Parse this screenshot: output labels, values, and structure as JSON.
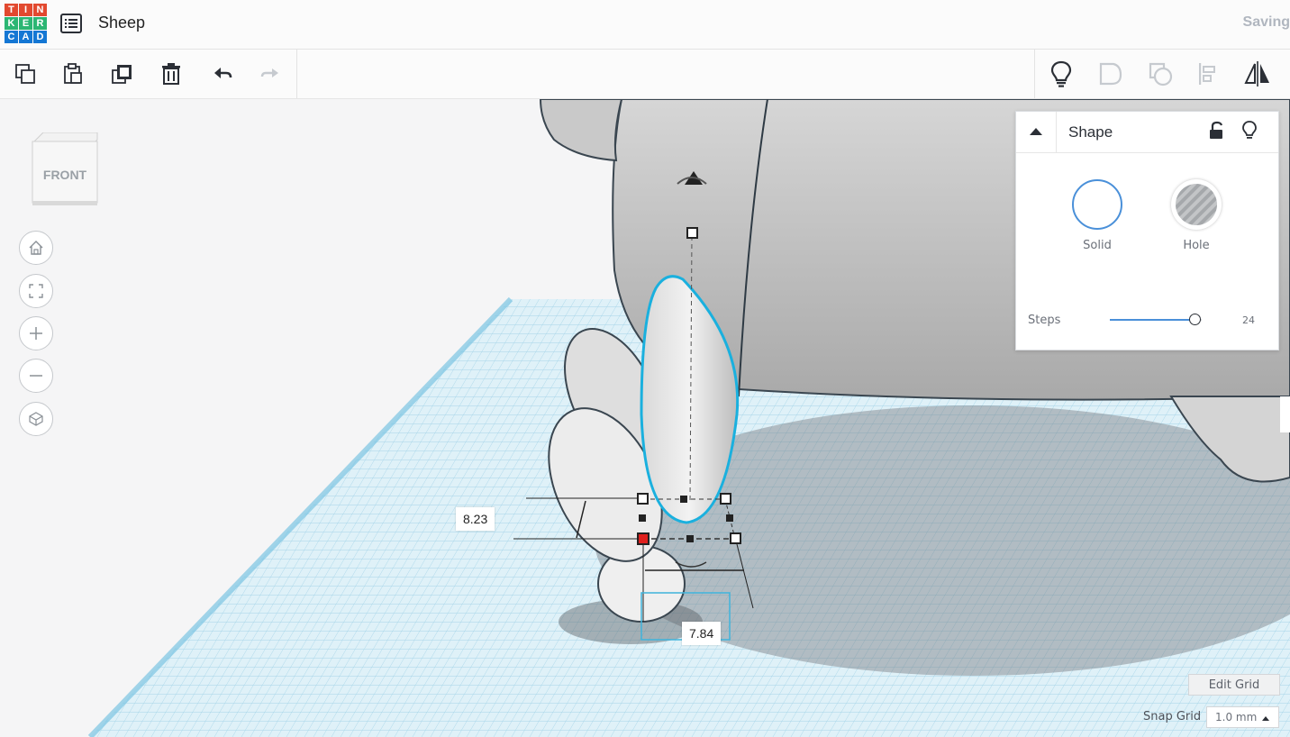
{
  "app": {
    "logo_letters": [
      "T",
      "I",
      "N",
      "K",
      "E",
      "R",
      "C",
      "A",
      "D"
    ],
    "logo_colors": [
      "#e2492f",
      "#e2492f",
      "#e2492f",
      "#2bb673",
      "#2bb673",
      "#2bb673",
      "#1477d4",
      "#1477d4",
      "#1477d4"
    ],
    "title": "Sheep",
    "status": "Saving"
  },
  "toolbar": {
    "left_icons": [
      "copy-icon",
      "paste-icon",
      "duplicate-icon",
      "trash-icon",
      "undo-icon",
      "redo-icon"
    ],
    "right_icons": [
      "lightbulb-icon",
      "group-icon",
      "ungroup-icon",
      "align-icon",
      "mirror-icon"
    ]
  },
  "viewcube": {
    "face_label": "FRONT"
  },
  "nav": [
    "home-icon",
    "fit-icon",
    "zoom-in-icon",
    "zoom-out-icon",
    "perspective-icon"
  ],
  "shape_panel": {
    "title": "Shape",
    "solid_label": "Solid",
    "hole_label": "Hole",
    "steps_label": "Steps",
    "steps_value": "24",
    "steps_fraction": 0.92
  },
  "dimensions": {
    "height": "8.23",
    "width": "7.84"
  },
  "grid": {
    "edit_label": "Edit Grid",
    "snap_label": "Snap Grid",
    "snap_value": "1.0 mm"
  },
  "colors": {
    "accent": "#1ab0de",
    "grid_blue": "#a9d8ec",
    "selected_handle": "#e0201d",
    "solid_ring": "#4a90d9"
  }
}
